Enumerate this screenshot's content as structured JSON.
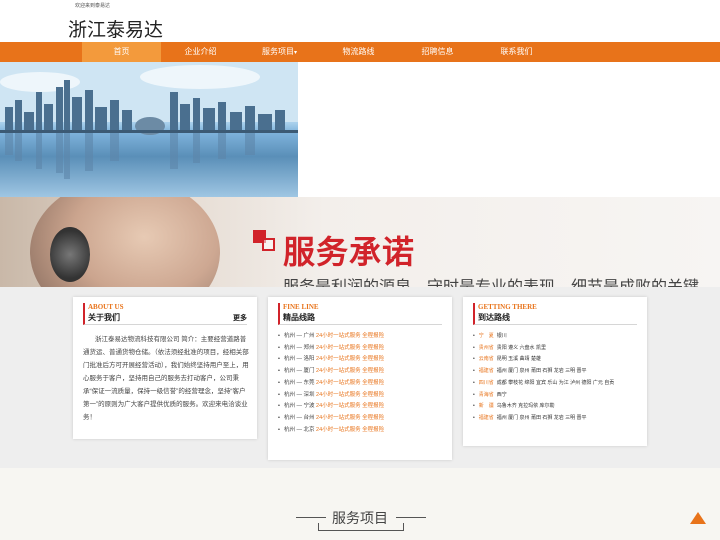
{
  "topbar": {
    "welcome": "欢迎来到泰易达"
  },
  "header": {
    "site_title": "浙江泰易达"
  },
  "nav": {
    "items": [
      {
        "label": "首页"
      },
      {
        "label": "企业介绍"
      },
      {
        "label": "服务项目"
      },
      {
        "label": "物流路线"
      },
      {
        "label": "招聘信息"
      },
      {
        "label": "联系我们"
      }
    ],
    "caret": "▾"
  },
  "banner2": {
    "title": "服务承诺",
    "subtitle": "服务是利润的源泉，守时是专业的表现，细节是成败的关键"
  },
  "about": {
    "en": "ABOUT US",
    "title": "关于我们",
    "more": "更多",
    "text": "浙江泰易达物流科技有限公司 简介：主要经营道路普通货运、普通货物仓储。（依法须经批准的项目，经相关部门批准后方可开展经营活动），我们始终坚持用户至上，用心服务于客户，坚持用自己的服务去打动客户，公司秉承“保证一流质量，保持一级信誉”的经营理念，坚持“客户第一”的原则为广大客户提供优质的服务。欢迎来电洽谈业务！"
  },
  "fine_line": {
    "en": "FINE LINE",
    "title": "精品线路",
    "routes": [
      {
        "route": "杭州 — 广州",
        "desc": "24小时一站式服务 全程报险"
      },
      {
        "route": "杭州 — 郑州",
        "desc": "24小时一站式服务 全程报险"
      },
      {
        "route": "杭州 — 洛阳",
        "desc": "24小时一站式服务 全程报险"
      },
      {
        "route": "杭州 — 厦门",
        "desc": "24小时一站式服务 全程报险"
      },
      {
        "route": "杭州 — 东莞",
        "desc": "24小时一站式服务 全程报险"
      },
      {
        "route": "杭州 — 深圳",
        "desc": "24小时一站式服务 全程报险"
      },
      {
        "route": "杭州 — 宁波",
        "desc": "24小时一站式服务 全程报险"
      },
      {
        "route": "杭州 — 台州",
        "desc": "24小时一站式服务 全程报险"
      },
      {
        "route": "杭州 — 北京",
        "desc": "24小时一站式服务 全程报险"
      }
    ]
  },
  "getting_there": {
    "en": "GETTING THERE",
    "title": "到达路线",
    "areas": [
      {
        "prov": "宁　夏",
        "cities": "银川"
      },
      {
        "prov": "贵州省",
        "cities": "贵阳 遵义 六盘水 凯里"
      },
      {
        "prov": "云南省",
        "cities": "昆明 玉溪 曲靖 楚雄"
      },
      {
        "prov": "福建省",
        "cities": "福州 厦门 泉州 莆田 石狮 龙岩 三明 晋平"
      },
      {
        "prov": "四川省",
        "cities": "成都 攀枝花 绵阳 宜宾 乐山 为江 泸州 德阳 广元 自贡"
      },
      {
        "prov": "青海省",
        "cities": "西宁"
      },
      {
        "prov": "新　疆",
        "cities": "乌鲁木齐 克拉玛依 库尔勒"
      },
      {
        "prov": "福建省",
        "cities": "福州 厦门 泉州 莆田 石狮 龙岩 三明 晋平"
      }
    ]
  },
  "services": {
    "title": "服务项目"
  },
  "colors": {
    "accent": "#e8731a",
    "nav_active": "#f39a3c",
    "promise_red": "#d1232a"
  },
  "icons": {
    "back_to_top": "arrow-up-icon",
    "route_bullet": "bullet-icon"
  }
}
